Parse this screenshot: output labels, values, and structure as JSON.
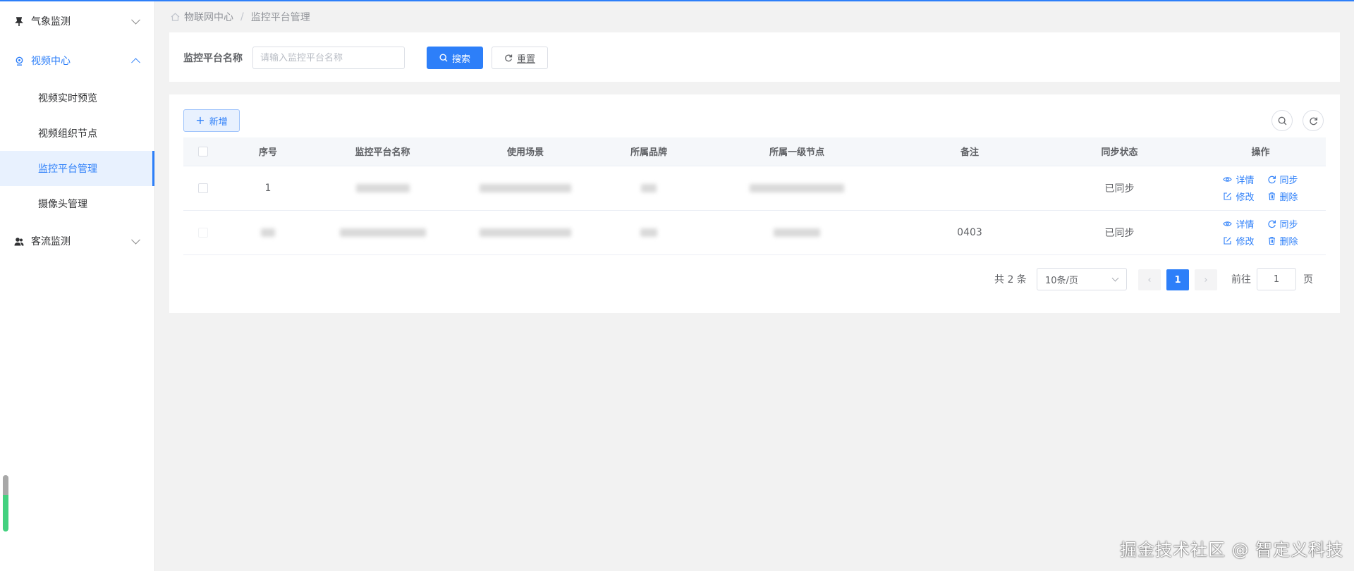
{
  "sidebar": {
    "groups": [
      {
        "label": "气象监测",
        "icon": "pin-icon",
        "expanded": false
      },
      {
        "label": "视频中心",
        "icon": "camera-icon",
        "expanded": true,
        "items": [
          {
            "label": "视频实时预览"
          },
          {
            "label": "视频组织节点"
          },
          {
            "label": "监控平台管理",
            "active": true
          },
          {
            "label": "摄像头管理"
          }
        ]
      },
      {
        "label": "客流监测",
        "icon": "users-icon",
        "expanded": false
      }
    ]
  },
  "breadcrumb": {
    "items": [
      "物联网中心",
      "监控平台管理"
    ],
    "separator": "/"
  },
  "search": {
    "label": "监控平台名称",
    "placeholder": "请输入监控平台名称",
    "search_button": "搜索",
    "reset_button": "重置"
  },
  "toolbar": {
    "add_button": "新增"
  },
  "table": {
    "columns": [
      "序号",
      "监控平台名称",
      "使用场景",
      "所属品牌",
      "所属一级节点",
      "备注",
      "同步状态",
      "操作"
    ],
    "rows": [
      {
        "index": "1",
        "remark": "",
        "sync_status": "已同步"
      },
      {
        "index": "",
        "remark": "0403",
        "sync_status": "已同步"
      }
    ],
    "actions": {
      "detail": "详情",
      "sync": "同步",
      "edit": "修改",
      "delete": "删除"
    }
  },
  "pagination": {
    "total_text": "共 2 条",
    "page_size": "10条/页",
    "current_page": "1",
    "goto_label": "前往",
    "goto_value": "1",
    "page_suffix": "页"
  },
  "watermark": "掘金技术社区 @ 智定义科技",
  "colors": {
    "primary": "#2d7ff9",
    "active_bg": "#e8f1fe",
    "page_bg": "#f2f2f2"
  }
}
